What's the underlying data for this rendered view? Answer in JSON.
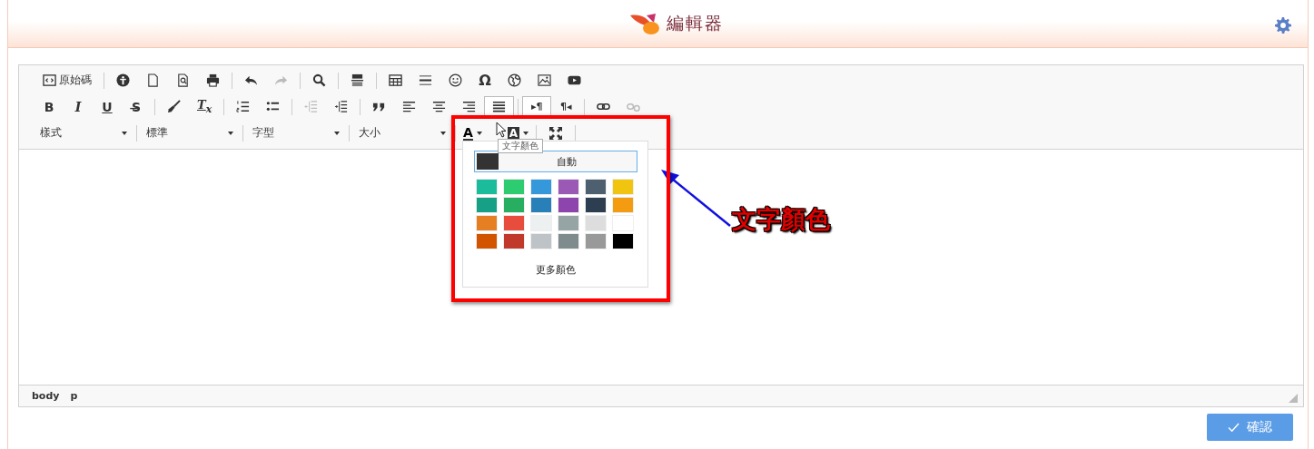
{
  "header": {
    "title": "編輯器"
  },
  "toolbar": {
    "rows": [
      {
        "groups": [
          {
            "items": [
              {
                "kind": "icon-text",
                "label": "原始碼",
                "disabled": false,
                "selected": false
              }
            ]
          },
          {
            "items": [
              {
                "kind": "icon",
                "disabled": false,
                "selected": false
              },
              {
                "kind": "icon",
                "disabled": false,
                "selected": false
              },
              {
                "kind": "icon",
                "disabled": false,
                "selected": false
              },
              {
                "kind": "icon",
                "disabled": false,
                "selected": false
              }
            ]
          },
          {
            "items": [
              {
                "kind": "icon",
                "disabled": false,
                "selected": false
              },
              {
                "kind": "icon",
                "disabled": true,
                "selected": false
              }
            ]
          },
          {
            "items": [
              {
                "kind": "icon",
                "disabled": false,
                "selected": false
              }
            ]
          },
          {
            "items": [
              {
                "kind": "icon",
                "disabled": false,
                "selected": false
              }
            ]
          },
          {
            "items": [
              {
                "kind": "icon",
                "disabled": false,
                "selected": false
              },
              {
                "kind": "icon",
                "disabled": false,
                "selected": false
              },
              {
                "kind": "icon",
                "disabled": false,
                "selected": false
              },
              {
                "kind": "symbol",
                "label": "Ω",
                "disabled": false,
                "selected": false
              },
              {
                "kind": "icon",
                "disabled": false,
                "selected": false
              },
              {
                "kind": "icon",
                "disabled": false,
                "selected": false
              },
              {
                "kind": "icon",
                "disabled": false,
                "selected": false
              }
            ]
          }
        ]
      },
      {
        "groups": [
          {
            "items": [
              {
                "kind": "bold",
                "label": "B",
                "disabled": false,
                "selected": false
              },
              {
                "kind": "italic",
                "label": "I",
                "disabled": false,
                "selected": false
              },
              {
                "kind": "underline",
                "label": "U",
                "disabled": false,
                "selected": false
              },
              {
                "kind": "strike",
                "label": "S̶",
                "disabled": false,
                "selected": false
              }
            ]
          },
          {
            "items": [
              {
                "kind": "icon",
                "disabled": false,
                "selected": false
              },
              {
                "kind": "clear",
                "label": "T$_{x}$",
                "disabled": false,
                "selected": false
              }
            ]
          },
          {
            "items": [
              {
                "kind": "icon",
                "disabled": false,
                "selected": false
              },
              {
                "kind": "icon",
                "disabled": false,
                "selected": false
              }
            ]
          },
          {
            "items": [
              {
                "kind": "icon",
                "disabled": true,
                "selected": false
              },
              {
                "kind": "icon",
                "disabled": false,
                "selected": false
              }
            ]
          },
          {
            "items": [
              {
                "kind": "icon",
                "disabled": false,
                "selected": false
              },
              {
                "kind": "icon",
                "disabled": false,
                "selected": false
              },
              {
                "kind": "icon",
                "disabled": false,
                "selected": false
              },
              {
                "kind": "icon",
                "disabled": false,
                "selected": false
              },
              {
                "kind": "icon",
                "disabled": false,
                "selected": true
              }
            ]
          },
          {
            "items": [
              {
                "kind": "dir",
                "label": "▸¶",
                "disabled": false,
                "selected": true
              },
              {
                "kind": "dir",
                "label": "¶◂",
                "disabled": false,
                "selected": false
              }
            ]
          },
          {
            "items": [
              {
                "kind": "icon",
                "disabled": false,
                "selected": false
              },
              {
                "kind": "icon",
                "disabled": true,
                "selected": false
              }
            ]
          }
        ]
      }
    ],
    "combos": [
      {
        "label": "樣式"
      },
      {
        "label": "標準"
      },
      {
        "label": "字型"
      },
      {
        "label": "大小"
      }
    ],
    "text_color": {
      "label": "A"
    },
    "bg_color": {
      "label": "A"
    },
    "tooltip": "文字顏色"
  },
  "color_panel": {
    "auto": {
      "color": "#333333",
      "label": "自動"
    },
    "colors": [
      {
        "color": "#1abc9c"
      },
      {
        "color": "#2ecc71"
      },
      {
        "color": "#3498db"
      },
      {
        "color": "#9b59b6"
      },
      {
        "color": "#4e5f70"
      },
      {
        "color": "#f1c40f"
      },
      {
        "color": "#16a085"
      },
      {
        "color": "#27ae60"
      },
      {
        "color": "#2980b9"
      },
      {
        "color": "#8e44ad"
      },
      {
        "color": "#2c3e50"
      },
      {
        "color": "#f39c12"
      },
      {
        "color": "#e67e22"
      },
      {
        "color": "#e74c3c"
      },
      {
        "color": "#ecf0f1"
      },
      {
        "color": "#95a5a6"
      },
      {
        "color": "#dddddd"
      },
      {
        "color": "#ffffff"
      },
      {
        "color": "#d35400"
      },
      {
        "color": "#c0392b"
      },
      {
        "color": "#bdc3c7"
      },
      {
        "color": "#7f8c8d"
      },
      {
        "color": "#999999"
      },
      {
        "color": "#000000"
      }
    ],
    "more": "更多顏色"
  },
  "annotation": {
    "label": "文字顏色"
  },
  "status_bar": {
    "path": [
      "body",
      "p"
    ]
  },
  "confirm_button": {
    "label": "確認"
  }
}
